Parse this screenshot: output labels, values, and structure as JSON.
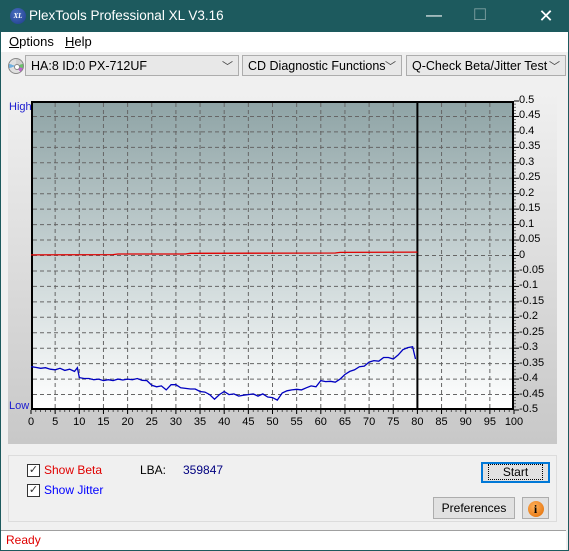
{
  "window": {
    "title": "PlexTools Professional XL V3.16",
    "app_icon_text": "XL",
    "minimize_glyph": "—",
    "maximize_glyph": "☐",
    "close_glyph": "✕"
  },
  "menu": {
    "items": [
      {
        "label": "Options",
        "accel": "O"
      },
      {
        "label": "Help",
        "accel": "H"
      }
    ]
  },
  "toolbar": {
    "drive_select": "HA:8 ID:0  PX-712UF",
    "function_select": "CD Diagnostic Functions",
    "test_select": "Q-Check Beta/Jitter Test",
    "dropdown_arrow": "﹀"
  },
  "graph": {
    "high_label": "High",
    "low_label": "Low"
  },
  "chart_data": {
    "type": "line",
    "title": "",
    "xlabel": "",
    "ylabel": "",
    "xlim": [
      0,
      100
    ],
    "ylim": [
      -0.5,
      0.5
    ],
    "x_ticks": [
      "0",
      "5",
      "10",
      "15",
      "20",
      "25",
      "30",
      "35",
      "40",
      "45",
      "50",
      "55",
      "60",
      "65",
      "70",
      "75",
      "80",
      "85",
      "90",
      "95",
      "100"
    ],
    "y_ticks_right": [
      "0.5",
      "0.45",
      "0.4",
      "0.35",
      "0.3",
      "0.25",
      "0.2",
      "0.15",
      "0.1",
      "0.05",
      "0",
      "-0.05",
      "-0.1",
      "-0.15",
      "-0.2",
      "-0.25",
      "-0.3",
      "-0.35",
      "-0.4",
      "-0.45",
      "-0.5"
    ],
    "grid": true,
    "end_marker_x": 80,
    "series": [
      {
        "name": "Beta",
        "color": "#e00000",
        "x": [
          0,
          17,
          18,
          32,
          33,
          63,
          64,
          80
        ],
        "y": [
          0.002,
          0.003,
          0.005,
          0.005,
          0.007,
          0.008,
          0.01,
          0.011
        ]
      },
      {
        "name": "Jitter",
        "color": "#0000c0",
        "x": [
          0,
          1,
          2,
          3,
          4,
          5,
          6,
          7,
          8,
          9,
          9.6,
          10,
          11,
          12,
          13,
          14,
          15,
          16,
          17,
          18,
          19,
          20,
          21,
          22,
          23,
          24,
          25,
          26,
          27,
          28,
          29,
          30,
          31,
          32,
          33,
          34,
          35,
          36,
          37,
          38,
          39,
          40,
          41,
          42,
          43,
          44,
          45,
          46,
          47,
          48,
          49,
          50,
          51,
          52,
          53,
          54,
          55,
          56,
          57,
          58,
          59,
          60,
          61,
          62,
          63,
          64,
          65,
          66,
          67,
          68,
          69,
          70,
          71,
          72,
          73,
          74,
          75,
          76,
          77,
          78,
          79,
          79.6
        ],
        "y": [
          -0.36,
          -0.362,
          -0.365,
          -0.363,
          -0.368,
          -0.37,
          -0.365,
          -0.372,
          -0.368,
          -0.375,
          -0.363,
          -0.395,
          -0.398,
          -0.398,
          -0.402,
          -0.4,
          -0.405,
          -0.402,
          -0.405,
          -0.4,
          -0.403,
          -0.4,
          -0.402,
          -0.398,
          -0.404,
          -0.405,
          -0.42,
          -0.425,
          -0.422,
          -0.435,
          -0.418,
          -0.418,
          -0.428,
          -0.43,
          -0.432,
          -0.432,
          -0.44,
          -0.442,
          -0.45,
          -0.465,
          -0.45,
          -0.44,
          -0.45,
          -0.448,
          -0.455,
          -0.452,
          -0.45,
          -0.448,
          -0.455,
          -0.448,
          -0.458,
          -0.46,
          -0.468,
          -0.445,
          -0.438,
          -0.435,
          -0.433,
          -0.435,
          -0.428,
          -0.422,
          -0.425,
          -0.405,
          -0.408,
          -0.407,
          -0.41,
          -0.4,
          -0.385,
          -0.375,
          -0.37,
          -0.36,
          -0.358,
          -0.345,
          -0.34,
          -0.342,
          -0.33,
          -0.33,
          -0.335,
          -0.322,
          -0.305,
          -0.298,
          -0.295,
          -0.335
        ]
      }
    ]
  },
  "controls": {
    "show_beta_label": "Show Beta",
    "show_beta_checked": true,
    "show_jitter_label": "Show Jitter",
    "show_jitter_checked": true,
    "lba_label": "LBA:",
    "lba_value": "359847",
    "start_label": "Start",
    "preferences_label": "Preferences",
    "info_icon_glyph": "i",
    "check_glyph": "✓"
  },
  "colors": {
    "beta": "#e00000",
    "jitter": "#0000ff",
    "lba_value": "#000080",
    "title_bar": "#1d5a5e",
    "status": "#e00000"
  },
  "status": {
    "text": "Ready"
  }
}
